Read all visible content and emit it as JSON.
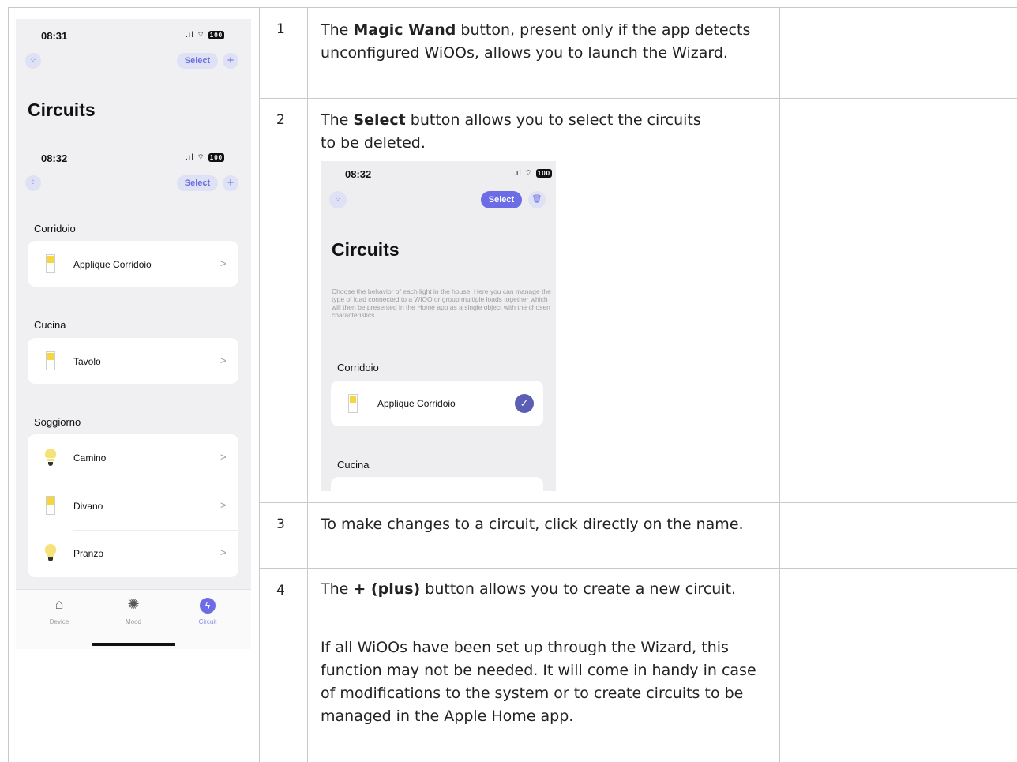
{
  "phone_main": {
    "time_top": "08:31",
    "battery": "100",
    "select_label": "Select",
    "plus_label": "+",
    "title": "Circuits",
    "time_inner": "08:32",
    "sections": [
      {
        "name": "Corridoio",
        "items": [
          {
            "label": "Applique Corridoio",
            "icon": "switch-icon"
          }
        ]
      },
      {
        "name": "Cucina",
        "items": [
          {
            "label": "Tavolo",
            "icon": "switch-icon"
          }
        ]
      },
      {
        "name": "Soggiorno",
        "items": [
          {
            "label": "Camino",
            "icon": "bulb-icon"
          },
          {
            "label": "Divano",
            "icon": "switch-icon"
          },
          {
            "label": "Pranzo",
            "icon": "bulb-icon"
          }
        ]
      }
    ],
    "chevron": ">",
    "tabs": [
      {
        "label": "Device",
        "icon": "house-icon"
      },
      {
        "label": "Mood",
        "icon": "palette-icon"
      },
      {
        "label": "Circuit",
        "icon": "bolt-icon"
      }
    ]
  },
  "phone_select": {
    "time": "08:32",
    "battery": "100",
    "select_label": "Select",
    "title": "Circuits",
    "description": "Choose the behavior of each light in the house. Here you can manage the type of load connected to a WiOO or group multiple loads together which will then be presented in the Home app as a single object with the chosen characteristics.",
    "section_1": "Corridoio",
    "item_1": "Applique Corridoio",
    "section_2": "Cucina",
    "check": "✓"
  },
  "rows": [
    {
      "number": "1",
      "pre": "The ",
      "bold": "Magic Wand",
      "post": " button, present only if the app detects unconfigured WiOOs, allows you to launch the Wizard."
    },
    {
      "number": "2",
      "pre": "The ",
      "bold": "Select",
      "post": " button allows you to select the circuits to be deleted."
    },
    {
      "number": "3",
      "text": "To make changes to a circuit, click directly on the name."
    },
    {
      "number": "4",
      "pre": "The ",
      "bold": "+ (plus)",
      "post": " button allows you to create a new circuit.",
      "extra": "If all WiOOs have been set up through the Wizard, this function may not be needed. It will come in handy in case of modifications to the system or to create circuits to be managed in the Apple Home app."
    }
  ],
  "colors": {
    "accent": "#6c6de6",
    "phone_bg": "#f0f0f2",
    "grid": "#c9c9c9",
    "switch_yellow": "#f5d63c"
  }
}
